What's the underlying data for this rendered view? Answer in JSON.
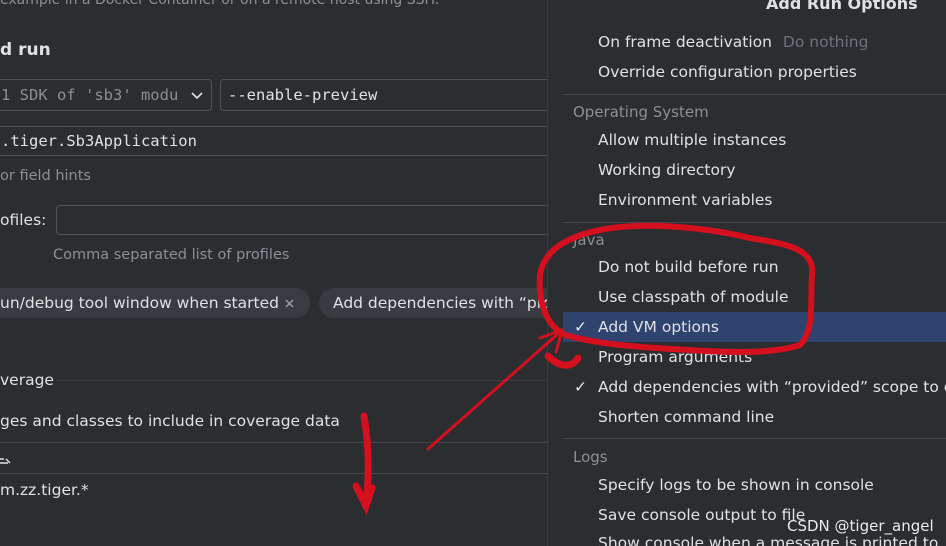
{
  "left": {
    "top_hint": "example in a Docker Container or on a remote host using SSH.",
    "section_title": "d run",
    "sdk_select": "1 SDK of 'sb3' modu",
    "vm_options": "--enable-preview",
    "main_class": ".tiger.Sb3Application",
    "field_hints": "or field hints",
    "profiles_label": "ofiles:",
    "profiles_hint": "Comma separated list of profiles",
    "chip1": "un/debug tool window when started",
    "chip2": "Add dependencies with “pro",
    "coverage_title": "verage",
    "coverage_desc": "ges and classes to include in coverage data",
    "coverage_item": "m.zz.tiger.*"
  },
  "popup": {
    "title": "Add Run Options",
    "items_top": [
      {
        "label": "On frame deactivation",
        "extra": "Do nothing"
      },
      {
        "label": "Override configuration properties"
      }
    ],
    "os_section": "Operating System",
    "os_items": [
      "Allow multiple instances",
      "Working directory",
      "Environment variables"
    ],
    "java_section": "Java",
    "java_items": [
      {
        "label": "Do not build before run",
        "checked": false
      },
      {
        "label": "Use classpath of module",
        "checked": false
      },
      {
        "label": "Add VM options",
        "checked": true,
        "selected": true
      },
      {
        "label": "Program arguments",
        "checked": false
      },
      {
        "label": "Add dependencies with “provided” scope to c",
        "checked": true
      },
      {
        "label": "Shorten command line",
        "checked": false
      }
    ],
    "logs_section": "Logs",
    "logs_items": [
      "Specify logs to be shown in console",
      "Save console output to file",
      "Show console when a message is printed to"
    ]
  },
  "watermark": "CSDN @tiger_angel",
  "icons": {
    "check": "check-icon",
    "chevron": "chevron-down-icon",
    "close": "close-icon"
  },
  "colors": {
    "background": "#2b2d30",
    "selection": "#2e436e",
    "annotation": "#d40f1e"
  }
}
